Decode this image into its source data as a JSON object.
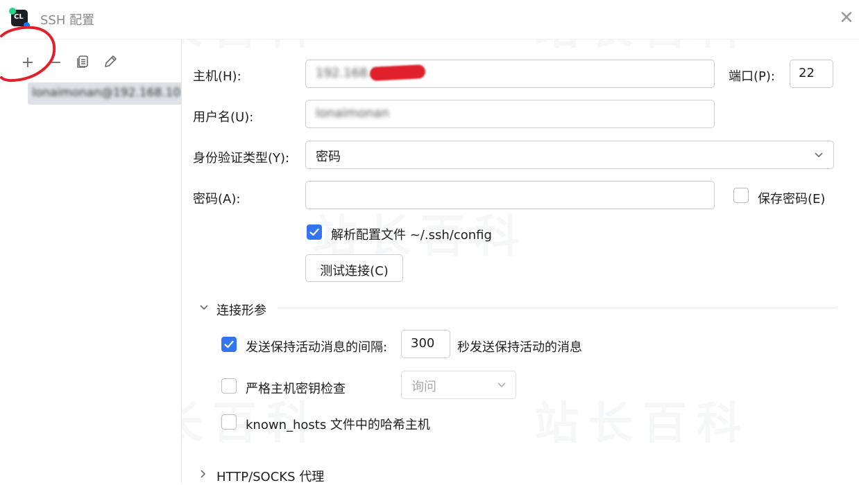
{
  "window": {
    "title": "SSH 配置",
    "close_glyph": "✕"
  },
  "toolbar": {
    "add": "+",
    "remove": "−",
    "copy_icon": "copy-icon",
    "edit_icon": "pencil-icon"
  },
  "host_list": {
    "selected": "lonaimonan@192.168.10"
  },
  "form": {
    "host_label": "主机(H):",
    "host_value": "192.168.10.101",
    "port_label": "端口(P):",
    "port_value": "22",
    "username_label": "用户名(U):",
    "username_value": "lonaimonan",
    "auth_label": "身份验证类型(Y):",
    "auth_value": "密码",
    "password_label": "密码(A):",
    "password_value": "",
    "save_password": {
      "label": "保存密码(E)",
      "checked": false
    },
    "parse_config": {
      "label": "解析配置文件 ~/.ssh/config",
      "checked": true
    },
    "test_button": "测试连接(C)"
  },
  "connection_params": {
    "title": "连接形参",
    "expanded": true,
    "keepalive": {
      "label": "发送保持活动消息的间隔:",
      "value": "300",
      "suffix": "秒发送保持活动的消息",
      "checked": true
    },
    "strict_host": {
      "label": "严格主机密钥检查",
      "checked": false,
      "select_value": "询问"
    },
    "hash_hosts": {
      "label": "known_hosts 文件中的哈希主机",
      "checked": false
    }
  },
  "proxy_section": {
    "title": "HTTP/SOCKS 代理",
    "expanded": false
  },
  "watermark": "站长百科",
  "colors": {
    "accent": "#3574f0",
    "selection": "#dfe2e8",
    "annotation": "#e0202b"
  }
}
